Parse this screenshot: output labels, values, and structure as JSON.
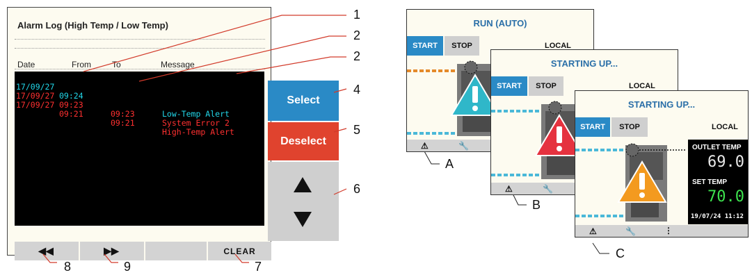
{
  "alarm_log": {
    "title": "Alarm Log (High Temp / Low Temp)",
    "columns": {
      "date": "Date",
      "from": "From",
      "to": "To",
      "message": "Message"
    },
    "rows": [
      {
        "date": "17/09/27",
        "from": "09:24",
        "to": "",
        "message": "Low-Temp Alert",
        "color": "#22d6e8"
      },
      {
        "date": "17/09/27",
        "from": "09:23",
        "to": "09:23",
        "message": "System Error 2",
        "color": "#ff3030"
      },
      {
        "date": "17/09/27",
        "from": "09:21",
        "to": "09:21",
        "message": "High-Temp Alert",
        "color": "#ff3030"
      }
    ],
    "select_label": "Select",
    "deselect_label": "Deselect",
    "up_glyph": "▲",
    "down_glyph": "▼",
    "prev_glyph": "◀◀",
    "next_glyph": "▶▶",
    "clear_label": "CLEAR"
  },
  "callouts": {
    "c1": "1",
    "c2a": "2",
    "c2b": "2",
    "c4": "4",
    "c5": "5",
    "c6": "6",
    "c7": "7",
    "c8": "8",
    "c9": "9",
    "cA": "A",
    "cB": "B",
    "cC": "C"
  },
  "screens": [
    {
      "title": "RUN (AUTO)",
      "start": "START",
      "stop": "STOP",
      "local": "LOCAL",
      "warning_color": "#2fb7c9"
    },
    {
      "title": "STARTING UP...",
      "start": "START",
      "stop": "STOP",
      "local": "LOCAL",
      "warning_color": "#e5323f"
    },
    {
      "title": "STARTING UP...",
      "start": "START",
      "stop": "STOP",
      "local": "LOCAL",
      "warning_color": "#f39a1f",
      "outlet_label": "OUTLET TEMP",
      "outlet_value": "69.0",
      "set_label": "SET TEMP",
      "set_value": "70.0",
      "datetime": "19/07/24 11:12"
    }
  ],
  "icons": {
    "footer_warning": "warning-icon",
    "footer_tools": "wrench-icon",
    "footer_more": "more-icon"
  },
  "colors": {
    "select": "#2a8ac6",
    "deselect": "#e0432e",
    "title_blue": "#2a6fa8"
  }
}
